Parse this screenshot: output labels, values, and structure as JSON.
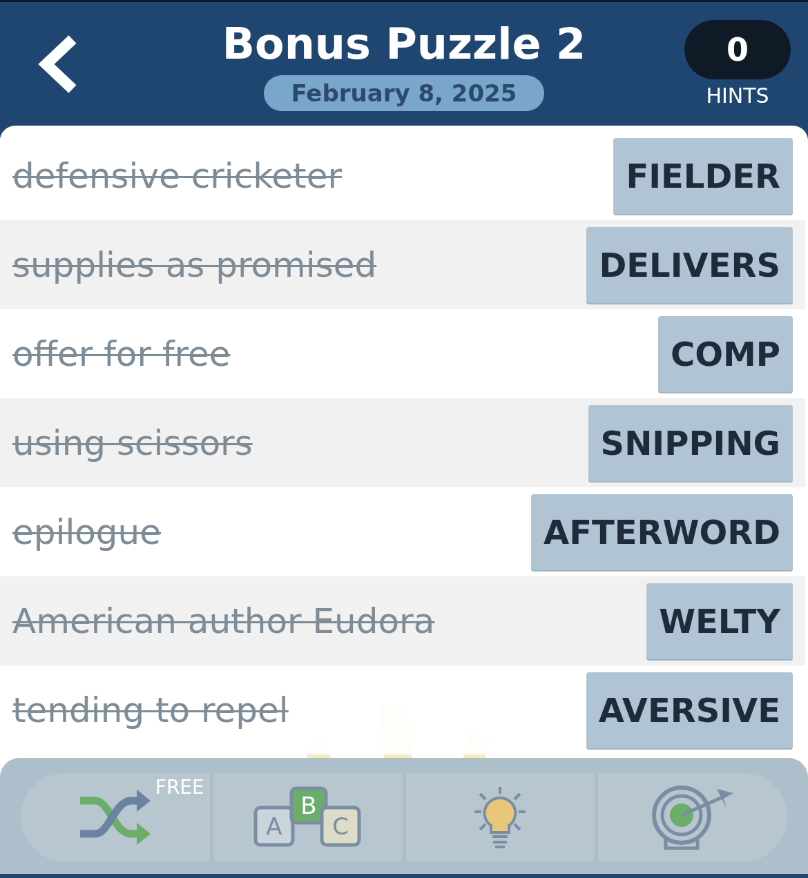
{
  "header": {
    "title": "Bonus Puzzle 2",
    "date": "February 8, 2025",
    "hints": {
      "count": "0",
      "label": "HINTS"
    }
  },
  "clues": [
    {
      "clue": "defensive cricketer",
      "answer": "FIELDER",
      "solved": true
    },
    {
      "clue": "supplies as promised",
      "answer": "DELIVERS",
      "solved": true
    },
    {
      "clue": "offer for free",
      "answer": "COMP",
      "solved": true
    },
    {
      "clue": "using scissors",
      "answer": "SNIPPING",
      "solved": true
    },
    {
      "clue": "epilogue",
      "answer": "AFTERWORD",
      "solved": true
    },
    {
      "clue": "American author Eudora",
      "answer": "WELTY",
      "solved": true
    },
    {
      "clue": "tending to repel",
      "answer": "AVERSIVE",
      "solved": true
    }
  ],
  "toolbar": [
    {
      "kind": "shuffle",
      "badge": "FREE"
    },
    {
      "kind": "letters",
      "letters": [
        "A",
        "B",
        "C"
      ]
    },
    {
      "kind": "hint"
    },
    {
      "kind": "target"
    }
  ]
}
